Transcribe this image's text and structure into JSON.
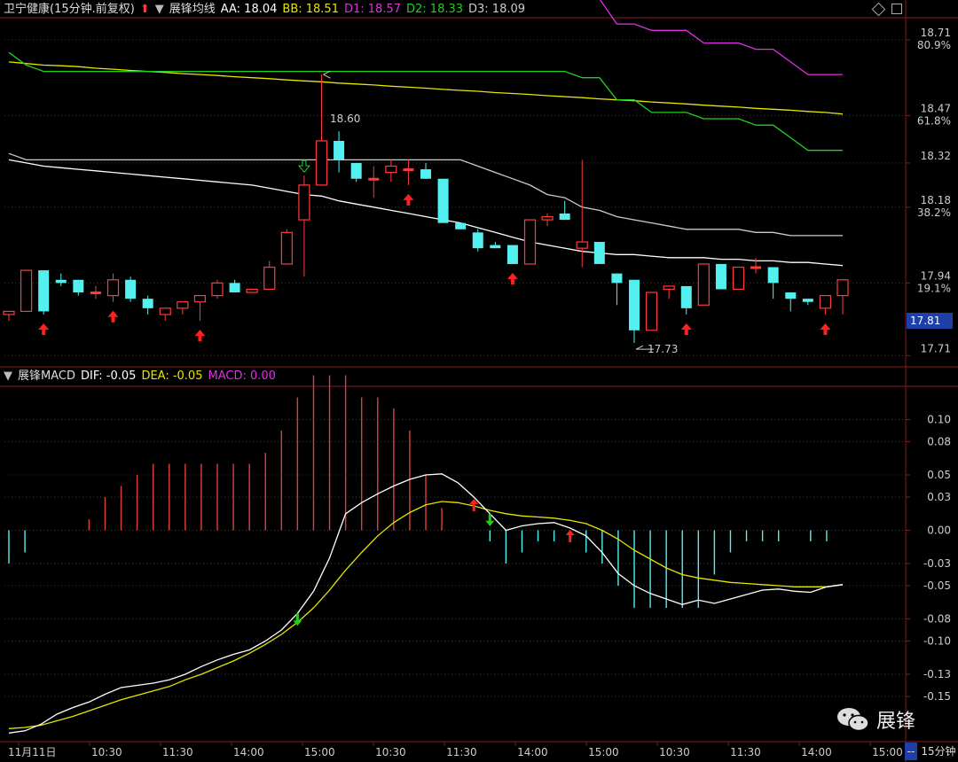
{
  "header_top": {
    "stock": "卫宁健康(15分钟.前复权)",
    "indicator": "展锋均线",
    "aa": "AA: 18.04",
    "bb": "BB: 18.51",
    "d1": "D1: 18.57",
    "d2": "D2: 18.33",
    "d3": "D3: 18.09"
  },
  "header_bottom": {
    "indicator": "展锋MACD",
    "dif": "DIF: -0.05",
    "dea": "DEA: -0.05",
    "macd": "MACD: 0.00"
  },
  "colors": {
    "up": "#ff3b3b",
    "down": "#54f0f0",
    "aa": "#ffffff",
    "bb": "#e6e600",
    "d1": "#e030e0",
    "d2": "#20d020",
    "d3": "#cccccc",
    "dif": "#ffffff",
    "dea": "#e6e600",
    "grid": "#8a1a1a",
    "badge": "#1f3fa8"
  },
  "price_axis": [
    {
      "label": "18.71",
      "pct": "80.9%"
    },
    {
      "label": "18.47",
      "pct": "61.8%"
    },
    {
      "label": "18.32",
      "pct": ""
    },
    {
      "label": "18.18",
      "pct": "38.2%"
    },
    {
      "label": "17.94",
      "pct": "19.1%"
    },
    {
      "label": "17.71",
      "pct": ""
    }
  ],
  "current_price": "17.81",
  "macd_axis": [
    "0.10",
    "0.08",
    "0.05",
    "0.03",
    "0.00",
    "-0.03",
    "-0.05",
    "-0.08",
    "-0.10",
    "-0.13",
    "-0.15"
  ],
  "time_axis": [
    "11月11日",
    "10:30",
    "11:30",
    "14:00",
    "15:00",
    "10:30",
    "11:30",
    "14:00",
    "15:00",
    "10:30",
    "11:30",
    "14:00",
    "15:00"
  ],
  "annotations": {
    "high": "18.60",
    "low": "17.73"
  },
  "period": "15分钟",
  "period_extra": "--",
  "watermark": "展锋",
  "chart_data": {
    "type": "candlestick",
    "price_range": [
      17.68,
      18.78
    ],
    "macd_range": [
      -0.19,
      0.13
    ],
    "candles": [
      [
        17.84,
        17.85,
        17.82,
        17.85
      ],
      [
        17.85,
        17.98,
        17.85,
        17.98
      ],
      [
        17.98,
        17.85,
        17.84,
        17.98
      ],
      [
        17.95,
        17.94,
        17.93,
        17.97
      ],
      [
        17.95,
        17.91,
        17.9,
        17.95
      ],
      [
        17.91,
        17.91,
        17.89,
        17.93
      ],
      [
        17.9,
        17.95,
        17.88,
        17.97
      ],
      [
        17.95,
        17.89,
        17.88,
        17.96
      ],
      [
        17.89,
        17.86,
        17.84,
        17.9
      ],
      [
        17.84,
        17.86,
        17.82,
        17.86
      ],
      [
        17.86,
        17.88,
        17.84,
        17.88
      ],
      [
        17.88,
        17.9,
        17.82,
        17.9
      ],
      [
        17.9,
        17.94,
        17.89,
        17.95
      ],
      [
        17.94,
        17.91,
        17.91,
        17.95
      ],
      [
        17.91,
        17.92,
        17.91,
        17.92
      ],
      [
        17.92,
        17.99,
        17.92,
        18.01
      ],
      [
        18.0,
        18.1,
        18.0,
        18.11
      ],
      [
        18.14,
        18.25,
        17.96,
        18.28
      ],
      [
        18.25,
        18.39,
        18.25,
        18.6
      ],
      [
        18.39,
        18.33,
        18.29,
        18.42
      ],
      [
        18.32,
        18.27,
        18.26,
        18.32
      ],
      [
        18.27,
        18.27,
        18.21,
        18.31
      ],
      [
        18.29,
        18.31,
        18.26,
        18.33
      ],
      [
        18.3,
        18.3,
        18.25,
        18.33
      ],
      [
        18.3,
        18.27,
        18.27,
        18.32
      ],
      [
        18.27,
        18.13,
        18.13,
        18.27
      ],
      [
        18.13,
        18.11,
        18.11,
        18.13
      ],
      [
        18.1,
        18.05,
        18.04,
        18.11
      ],
      [
        18.06,
        18.05,
        18.05,
        18.07
      ],
      [
        18.06,
        18.0,
        18.0,
        18.06
      ],
      [
        18.0,
        18.14,
        18.0,
        18.14
      ],
      [
        18.14,
        18.15,
        18.12,
        18.16
      ],
      [
        18.16,
        18.14,
        18.14,
        18.2
      ],
      [
        18.05,
        18.07,
        17.99,
        18.33
      ],
      [
        18.07,
        18.0,
        18.0,
        18.07
      ],
      [
        17.97,
        17.94,
        17.87,
        17.97
      ],
      [
        17.95,
        17.79,
        17.75,
        17.95
      ],
      [
        17.79,
        17.91,
        17.79,
        17.91
      ],
      [
        17.92,
        17.93,
        17.89,
        17.93
      ],
      [
        17.93,
        17.86,
        17.84,
        17.93
      ],
      [
        17.87,
        18.0,
        17.87,
        18.0
      ],
      [
        18.0,
        17.92,
        17.92,
        18.0
      ],
      [
        17.92,
        17.99,
        17.92,
        17.99
      ],
      [
        17.99,
        17.99,
        17.97,
        18.02
      ],
      [
        17.99,
        17.94,
        17.89,
        17.99
      ],
      [
        17.91,
        17.89,
        17.85,
        17.91
      ],
      [
        17.89,
        17.88,
        17.87,
        17.89
      ],
      [
        17.86,
        17.9,
        17.84,
        17.9
      ],
      [
        17.9,
        17.95,
        17.84,
        17.95
      ]
    ],
    "aa": [
      18.33,
      18.32,
      18.31,
      18.305,
      18.3,
      18.295,
      18.29,
      18.285,
      18.28,
      18.275,
      18.27,
      18.265,
      18.26,
      18.255,
      18.25,
      18.24,
      18.23,
      18.22,
      18.215,
      18.2,
      18.19,
      18.18,
      18.17,
      18.16,
      18.15,
      18.14,
      18.13,
      18.115,
      18.1,
      18.085,
      18.07,
      18.06,
      18.05,
      18.04,
      18.035,
      18.03,
      18.03,
      18.025,
      18.02,
      18.02,
      18.02,
      18.015,
      18.015,
      18.01,
      18.01,
      18.005,
      18.005,
      18.0,
      17.995
    ],
    "bb": [
      18.64,
      18.635,
      18.63,
      18.628,
      18.625,
      18.62,
      18.617,
      18.613,
      18.61,
      18.607,
      18.603,
      18.6,
      18.597,
      18.593,
      18.59,
      18.587,
      18.583,
      18.58,
      18.577,
      18.573,
      18.57,
      18.567,
      18.563,
      18.56,
      18.557,
      18.553,
      18.55,
      18.547,
      18.543,
      18.54,
      18.537,
      18.533,
      18.53,
      18.527,
      18.523,
      18.52,
      18.517,
      18.513,
      18.51,
      18.507,
      18.503,
      18.5,
      18.497,
      18.493,
      18.49,
      18.487,
      18.483,
      18.48,
      18.475
    ],
    "d1": [
      18.92,
      18.88,
      18.88,
      18.88,
      18.88,
      18.88,
      18.88,
      18.88,
      18.88,
      18.88,
      18.88,
      18.88,
      18.88,
      18.88,
      18.88,
      18.88,
      18.88,
      18.88,
      18.88,
      18.88,
      18.88,
      18.88,
      18.88,
      18.88,
      18.88,
      18.88,
      18.88,
      18.88,
      18.88,
      18.88,
      18.88,
      18.88,
      18.88,
      18.84,
      18.84,
      18.76,
      18.76,
      18.74,
      18.74,
      18.74,
      18.7,
      18.7,
      18.7,
      18.68,
      18.68,
      18.64,
      18.6,
      18.6,
      18.6
    ],
    "d2": [
      18.67,
      18.63,
      18.61,
      18.61,
      18.61,
      18.61,
      18.61,
      18.61,
      18.61,
      18.61,
      18.61,
      18.61,
      18.61,
      18.61,
      18.61,
      18.61,
      18.61,
      18.61,
      18.61,
      18.61,
      18.61,
      18.61,
      18.61,
      18.61,
      18.61,
      18.61,
      18.61,
      18.61,
      18.61,
      18.61,
      18.61,
      18.61,
      18.61,
      18.59,
      18.59,
      18.52,
      18.52,
      18.48,
      18.48,
      18.48,
      18.46,
      18.46,
      18.46,
      18.44,
      18.44,
      18.4,
      18.36,
      18.36,
      18.36
    ],
    "d3": [
      18.35,
      18.33,
      18.33,
      18.33,
      18.33,
      18.33,
      18.33,
      18.33,
      18.33,
      18.33,
      18.33,
      18.33,
      18.33,
      18.33,
      18.33,
      18.33,
      18.33,
      18.33,
      18.33,
      18.33,
      18.33,
      18.33,
      18.33,
      18.33,
      18.33,
      18.33,
      18.33,
      18.31,
      18.29,
      18.27,
      18.25,
      18.22,
      18.21,
      18.18,
      18.17,
      18.15,
      18.14,
      18.13,
      18.12,
      18.11,
      18.11,
      18.11,
      18.11,
      18.1,
      18.1,
      18.09,
      18.09,
      18.09,
      18.09
    ],
    "macd": [
      -0.03,
      -0.02,
      0,
      0,
      0,
      0.01,
      0.03,
      0.04,
      0.05,
      0.06,
      0.06,
      0.06,
      0.06,
      0.06,
      0.06,
      0.06,
      0.07,
      0.09,
      0.12,
      0.14,
      0.14,
      0.14,
      0.12,
      0.12,
      0.11,
      0.09,
      0.05,
      0.02,
      0,
      0,
      -0.01,
      -0.03,
      -0.02,
      -0.01,
      -0.01,
      0,
      -0.02,
      -0.03,
      -0.05,
      -0.07,
      -0.07,
      -0.07,
      -0.07,
      -0.07,
      -0.04,
      -0.02,
      -0.01,
      -0.01,
      -0.01,
      0,
      -0.01,
      -0.01,
      0
    ],
    "dif": [
      -0.183,
      -0.181,
      -0.175,
      -0.166,
      -0.16,
      -0.155,
      -0.148,
      -0.142,
      -0.14,
      -0.138,
      -0.135,
      -0.13,
      -0.123,
      -0.117,
      -0.112,
      -0.108,
      -0.1,
      -0.09,
      -0.075,
      -0.055,
      -0.025,
      0.015,
      0.025,
      0.033,
      0.04,
      0.046,
      0.05,
      0.051,
      0.043,
      0.03,
      0.015,
      0.0,
      0.004,
      0.006,
      0.007,
      0.002,
      -0.005,
      -0.02,
      -0.039,
      -0.05,
      -0.057,
      -0.062,
      -0.067,
      -0.063,
      -0.066,
      -0.062,
      -0.058,
      -0.054,
      -0.053,
      -0.055,
      -0.056,
      -0.051,
      -0.049
    ],
    "dea": [
      -0.179,
      -0.178,
      -0.176,
      -0.172,
      -0.168,
      -0.163,
      -0.158,
      -0.153,
      -0.149,
      -0.145,
      -0.141,
      -0.135,
      -0.13,
      -0.124,
      -0.118,
      -0.111,
      -0.103,
      -0.094,
      -0.083,
      -0.07,
      -0.054,
      -0.036,
      -0.02,
      -0.005,
      0.007,
      0.016,
      0.023,
      0.026,
      0.025,
      0.022,
      0.018,
      0.015,
      0.013,
      0.012,
      0.011,
      0.009,
      0.006,
      0.0,
      -0.008,
      -0.018,
      -0.026,
      -0.034,
      -0.04,
      -0.043,
      -0.045,
      -0.047,
      -0.048,
      -0.049,
      -0.05,
      -0.051,
      -0.051,
      -0.051,
      -0.049
    ],
    "signals_up_idx": [
      2,
      6,
      11,
      23,
      29,
      39,
      47
    ],
    "signals_down_idx": [
      17
    ],
    "macd_buy_idx": [
      29,
      35
    ],
    "macd_sell_idx": [
      18,
      30
    ]
  }
}
